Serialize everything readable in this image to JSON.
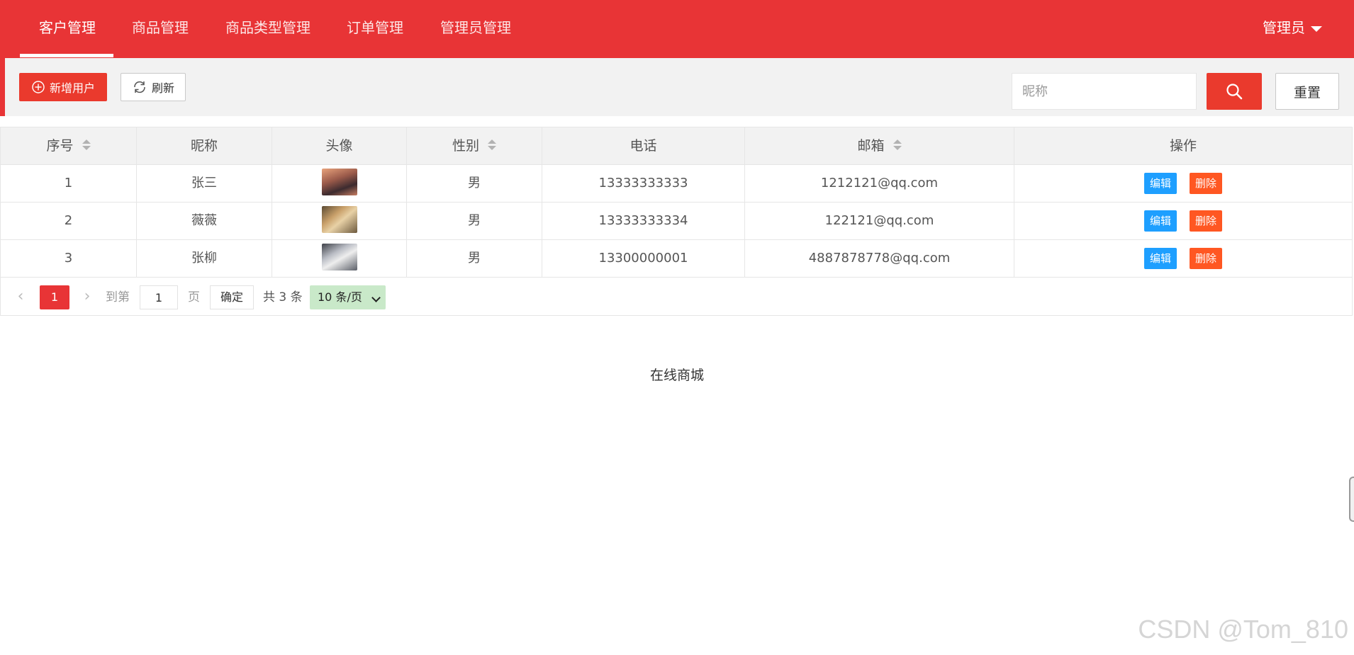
{
  "nav": {
    "tabs": [
      {
        "label": "客户管理",
        "active": true
      },
      {
        "label": "商品管理",
        "active": false
      },
      {
        "label": "商品类型管理",
        "active": false
      },
      {
        "label": "订单管理",
        "active": false
      },
      {
        "label": "管理员管理",
        "active": false
      }
    ],
    "user_menu_label": "管理员"
  },
  "toolbar": {
    "add_label": "新增用户",
    "refresh_label": "刷新",
    "search_placeholder": "昵称",
    "search_value": "",
    "reset_label": "重置"
  },
  "table": {
    "columns": [
      {
        "label": "序号",
        "sortable": true
      },
      {
        "label": "昵称",
        "sortable": false
      },
      {
        "label": "头像",
        "sortable": false
      },
      {
        "label": "性别",
        "sortable": true
      },
      {
        "label": "电话",
        "sortable": false
      },
      {
        "label": "邮箱",
        "sortable": true
      },
      {
        "label": "操作",
        "sortable": false
      }
    ],
    "rows": [
      {
        "id": "1",
        "nickname": "张三",
        "gender": "男",
        "phone": "13333333333",
        "email": "1212121@qq.com"
      },
      {
        "id": "2",
        "nickname": "薇薇",
        "gender": "男",
        "phone": "13333333334",
        "email": "122121@qq.com"
      },
      {
        "id": "3",
        "nickname": "张柳",
        "gender": "男",
        "phone": "13300000001",
        "email": "4887878778@qq.com"
      }
    ],
    "edit_label": "编辑",
    "delete_label": "删除"
  },
  "pager": {
    "current_page": "1",
    "goto_prefix": "到第",
    "goto_value": "1",
    "goto_suffix": "页",
    "confirm_label": "确定",
    "total_text": "共 3 条",
    "page_size": "10 条/页"
  },
  "footer": {
    "text": "在线商城"
  },
  "watermark": "CSDN @Tom_810",
  "colors": {
    "brand_red": "#e83436",
    "edit_blue": "#1e9fff",
    "delete_orange": "#ff5722",
    "page_size_green": "#c9e9c9"
  }
}
